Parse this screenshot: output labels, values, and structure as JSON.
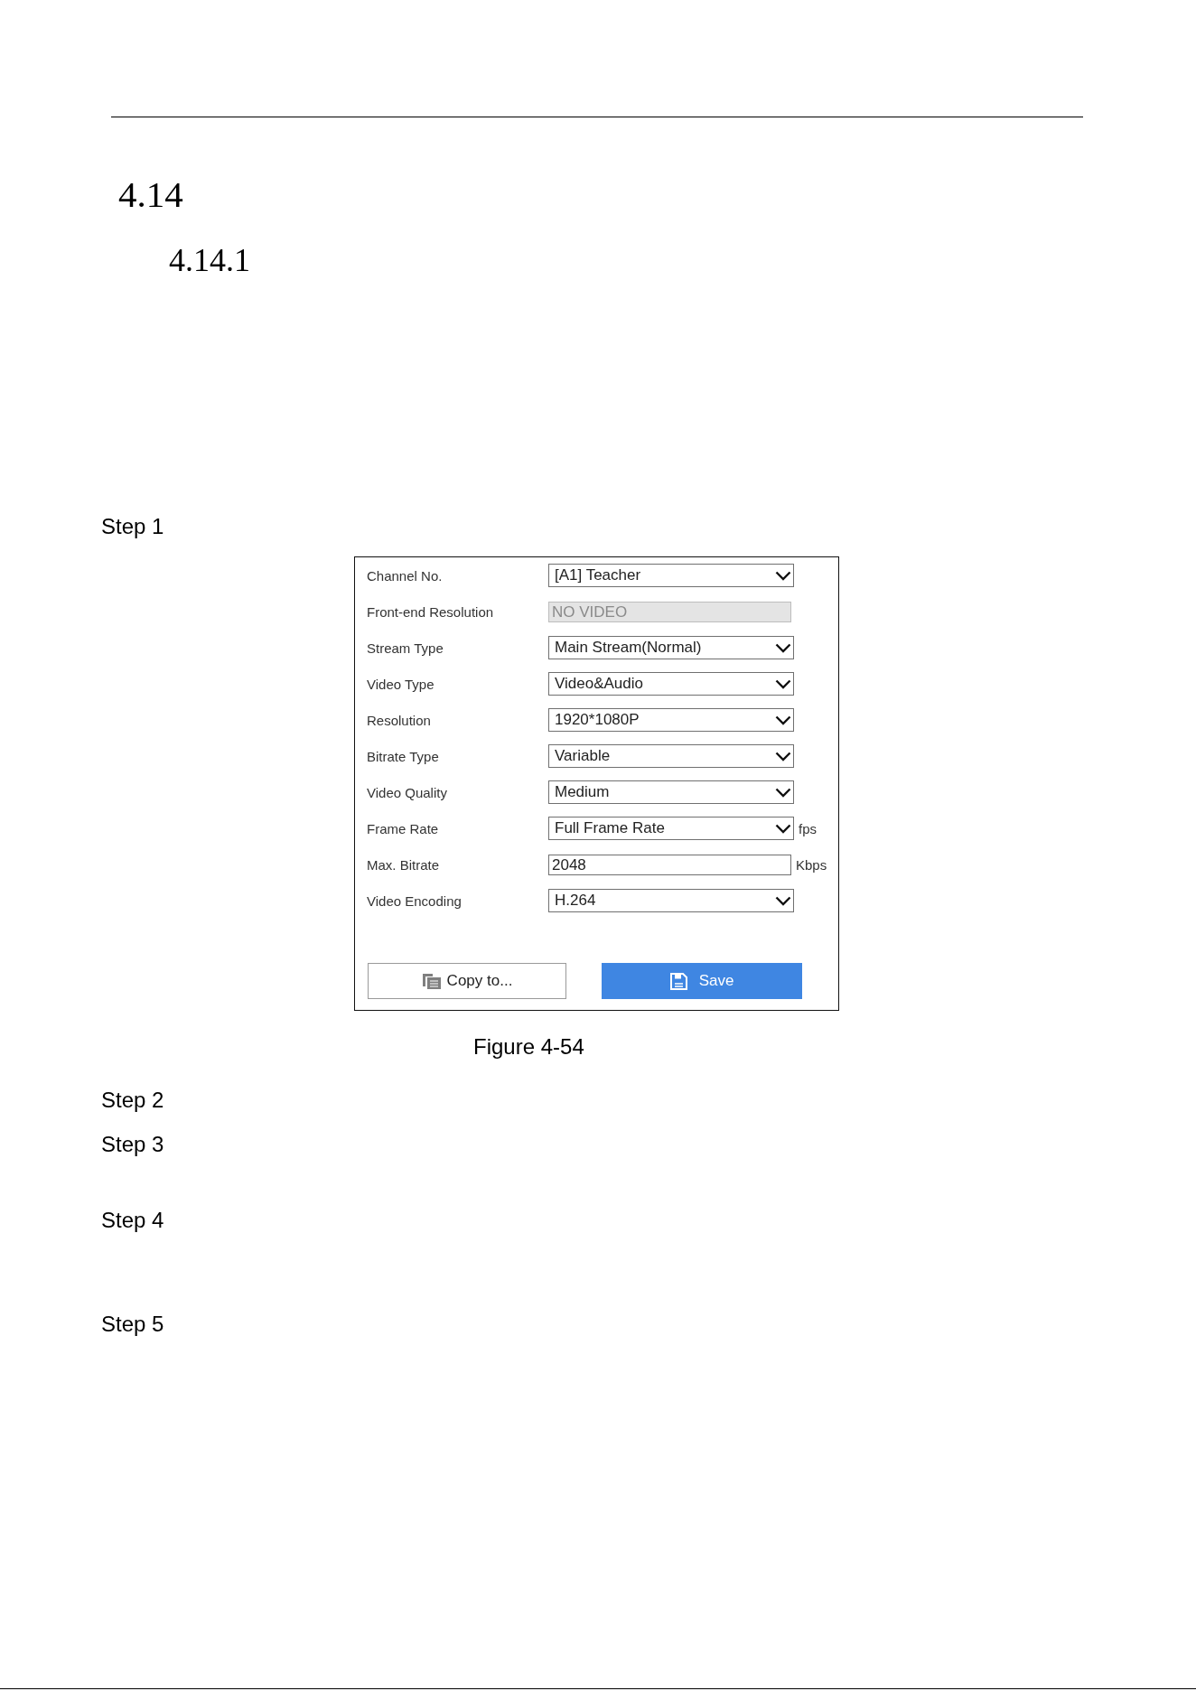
{
  "section_heading": "4.14",
  "subsection_heading": "4.14.1",
  "steps": [
    {
      "label": "Step 1",
      "figure": {
        "fields": [
          {
            "label": "Channel No.",
            "kind": "dropdown",
            "value": "[A1] Teacher",
            "disabled": false
          },
          {
            "label": "Front-end Resolution",
            "kind": "text",
            "value": "NO VIDEO",
            "disabled": true
          },
          {
            "label": "Stream Type",
            "kind": "dropdown",
            "value": "Main Stream(Normal)",
            "disabled": false
          },
          {
            "label": "Video Type",
            "kind": "dropdown",
            "value": "Video&Audio",
            "disabled": false
          },
          {
            "label": "Resolution",
            "kind": "dropdown",
            "value": "1920*1080P",
            "disabled": false
          },
          {
            "label": "Bitrate Type",
            "kind": "dropdown",
            "value": "Variable",
            "disabled": false
          },
          {
            "label": "Video Quality",
            "kind": "dropdown",
            "value": "Medium",
            "disabled": false
          },
          {
            "label": "Frame Rate",
            "kind": "dropdown",
            "value": "Full Frame Rate",
            "unit": "fps",
            "disabled": false
          },
          {
            "label": "Max. Bitrate",
            "kind": "text",
            "value": "2048",
            "unit": "Kbps",
            "disabled": false
          },
          {
            "label": "Video Encoding",
            "kind": "dropdown",
            "value": "H.264",
            "disabled": false
          }
        ],
        "buttons": [
          {
            "label": "Copy to...",
            "kind": "secondary"
          },
          {
            "label": "Save",
            "kind": "primary"
          }
        ],
        "caption": "Figure 4-54"
      }
    },
    {
      "label": "Step 2"
    },
    {
      "label": "Step 3"
    },
    {
      "label": "Step 4"
    },
    {
      "label": "Step 5"
    }
  ]
}
